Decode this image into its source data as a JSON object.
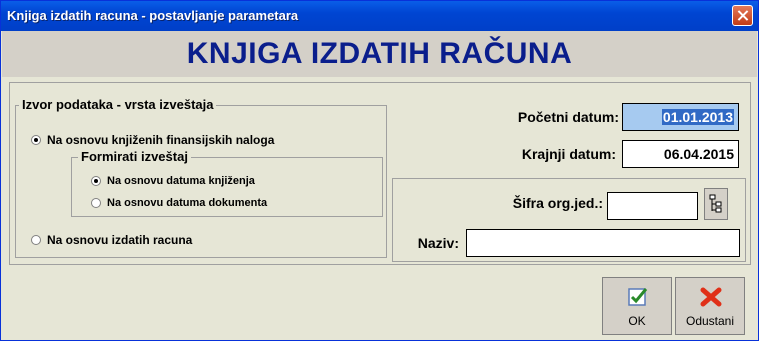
{
  "window": {
    "title": "Knjiga izdatih racuna - postavljanje parametara"
  },
  "banner": {
    "title": "KNJIGA IZDATIH RAČUNA"
  },
  "source_group": {
    "legend": "Izvor podataka - vrsta izveštaja",
    "option_financial": "Na osnovu knjiženih finansijskih naloga",
    "option_financial_selected": true,
    "format_group": {
      "legend": "Formirati izveštaj",
      "option_posting_date": "Na osnovu datuma knjiženja",
      "option_posting_date_selected": true,
      "option_document_date": "Na osnovu datuma dokumenta",
      "option_document_date_selected": false
    },
    "option_invoices": "Na osnovu izdatih racuna",
    "option_invoices_selected": false
  },
  "dates": {
    "start_label": "Početni datum:",
    "start_value": "01.01.2013",
    "end_label": "Krajnji datum:",
    "end_value": "06.04.2015"
  },
  "org": {
    "code_label": "Šifra org.jed.:",
    "code_value": "",
    "name_label": "Naziv:",
    "name_value": ""
  },
  "buttons": {
    "ok": "OK",
    "cancel": "Odustani"
  },
  "icons": {
    "lookup": "tree-lookup-icon",
    "ok": "checkmark-icon",
    "cancel": "red-x-icon"
  },
  "colors": {
    "title_bar": "#0a5ee8",
    "banner_text": "#0a1e8c",
    "selection": "#316ac5"
  }
}
